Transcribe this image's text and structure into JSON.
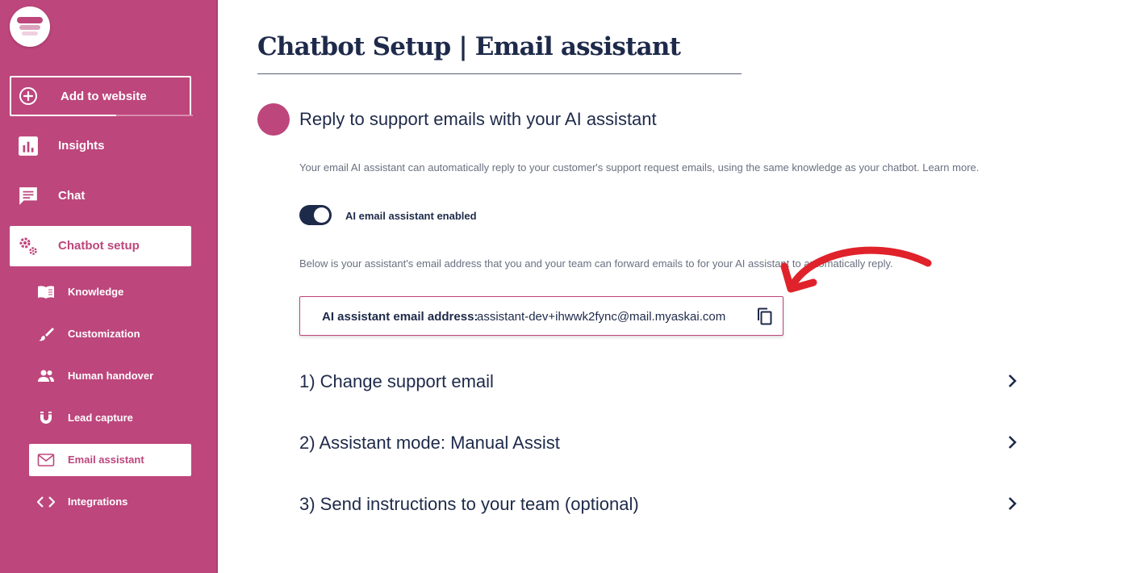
{
  "sidebar": {
    "add_button_label": "Add to website",
    "nav": [
      {
        "label": "Insights"
      },
      {
        "label": "Chat"
      },
      {
        "label": "Chatbot setup"
      }
    ],
    "sub_nav": [
      {
        "label": "Knowledge",
        "icon": "book-icon"
      },
      {
        "label": "Customization",
        "icon": "brush-icon"
      },
      {
        "label": "Human handover",
        "icon": "people-icon"
      },
      {
        "label": "Lead capture",
        "icon": "magnet-icon"
      },
      {
        "label": "Email assistant",
        "icon": "mail-icon"
      },
      {
        "label": "Integrations",
        "icon": "code-icon"
      }
    ],
    "active_nav": "Chatbot setup",
    "active_sub_nav": "Email assistant"
  },
  "main": {
    "title": "Chatbot Setup | Email assistant",
    "section_heading": "Reply to support emails with your AI assistant",
    "description": "Your email AI assistant can automatically reply to your customer's support request emails, using the same knowledge as your chatbot. Learn more.",
    "toggle": {
      "label": "AI email assistant enabled",
      "enabled": true
    },
    "forward_text": "Below is your assistant's email address that you and your team can forward emails to for your AI assistant to automatically reply.",
    "email_box": {
      "label": "AI assistant email address:",
      "value": "assistant-dev+ihwwk2fync@mail.myaskai.com"
    },
    "accordion": [
      {
        "label": "1) Change support email"
      },
      {
        "label": "2) Assistant mode: Manual Assist"
      },
      {
        "label": "3) Send instructions to your team (optional)"
      }
    ]
  },
  "colors": {
    "brand": "#bd467c",
    "navy": "#1e2a4a",
    "annotation_red": "#e0222b"
  }
}
